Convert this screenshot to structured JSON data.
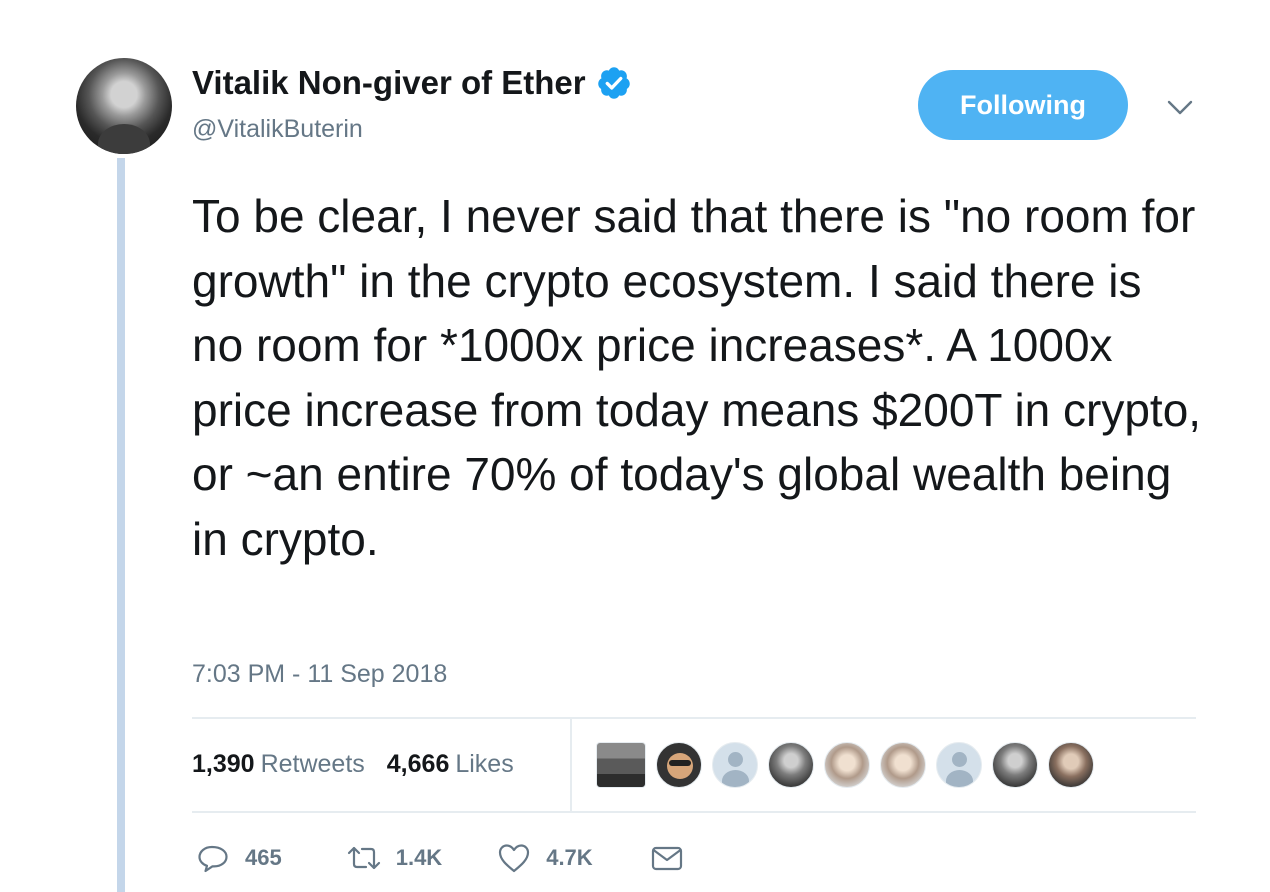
{
  "author": {
    "name": "Vitalik Non-giver of Ether",
    "handle": "@VitalikButerin",
    "verified": true
  },
  "follow_button": {
    "label": "Following"
  },
  "tweet": {
    "text": "To be clear, I never said that there is \"no room for growth\" in the crypto ecosystem. I said there is no room for *1000x price increases*. A 1000x price increase from today means $200T in crypto, or ~an entire 70% of today's global wealth being in crypto.",
    "timestamp": "7:03 PM - 11 Sep 2018"
  },
  "stats": {
    "retweets_count": "1,390",
    "retweets_label": "Retweets",
    "likes_count": "4,666",
    "likes_label": "Likes"
  },
  "actions": {
    "reply_count": "465",
    "retweet_count": "1.4K",
    "like_count": "4.7K"
  },
  "colors": {
    "accent": "#4fb3f3",
    "verified": "#1da1f2",
    "secondary_text": "#657786",
    "thread_line": "#c4d6ea"
  }
}
